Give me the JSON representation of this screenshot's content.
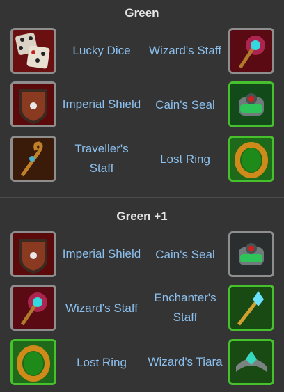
{
  "sections": [
    {
      "title": "Green",
      "rows": [
        {
          "left": {
            "name": "Lucky Dice",
            "icon": "lucky-dice-icon",
            "rarity": "gray"
          },
          "right": {
            "name": "Wizard's Staff",
            "icon": "wizard-staff-icon",
            "rarity": "gray"
          }
        },
        {
          "left": {
            "name": "Imperial Shield",
            "icon": "imperial-shield-icon",
            "rarity": "gray"
          },
          "right": {
            "name": "Cain's Seal",
            "icon": "cains-seal-icon",
            "rarity": "green"
          }
        },
        {
          "left": {
            "name": "Traveller's Staff",
            "icon": "travellers-staff-icon",
            "rarity": "gray"
          },
          "right": {
            "name": "Lost Ring",
            "icon": "lost-ring-icon",
            "rarity": "green"
          }
        }
      ]
    },
    {
      "title": "Green +1",
      "rows": [
        {
          "left": {
            "name": "Imperial Shield",
            "icon": "imperial-shield-icon",
            "rarity": "gray"
          },
          "right": {
            "name": "Cain's Seal",
            "icon": "cains-seal-icon",
            "rarity": "gray"
          }
        },
        {
          "left": {
            "name": "Wizard's Staff",
            "icon": "wizard-staff-icon",
            "rarity": "gray"
          },
          "right": {
            "name": "Enchanter's Staff",
            "icon": "enchanters-staff-icon",
            "rarity": "green"
          }
        },
        {
          "left": {
            "name": "Lost Ring",
            "icon": "lost-ring-icon",
            "rarity": "green"
          },
          "right": {
            "name": "Wizard's Tiara",
            "icon": "wizards-tiara-icon",
            "rarity": "green"
          }
        }
      ]
    }
  ],
  "colors": {
    "background": "#343434",
    "title": "#e6e6e6",
    "item_label": "#8cc0ee",
    "green_frame": "#47c02e",
    "gray_frame": "#8e8e8e"
  }
}
